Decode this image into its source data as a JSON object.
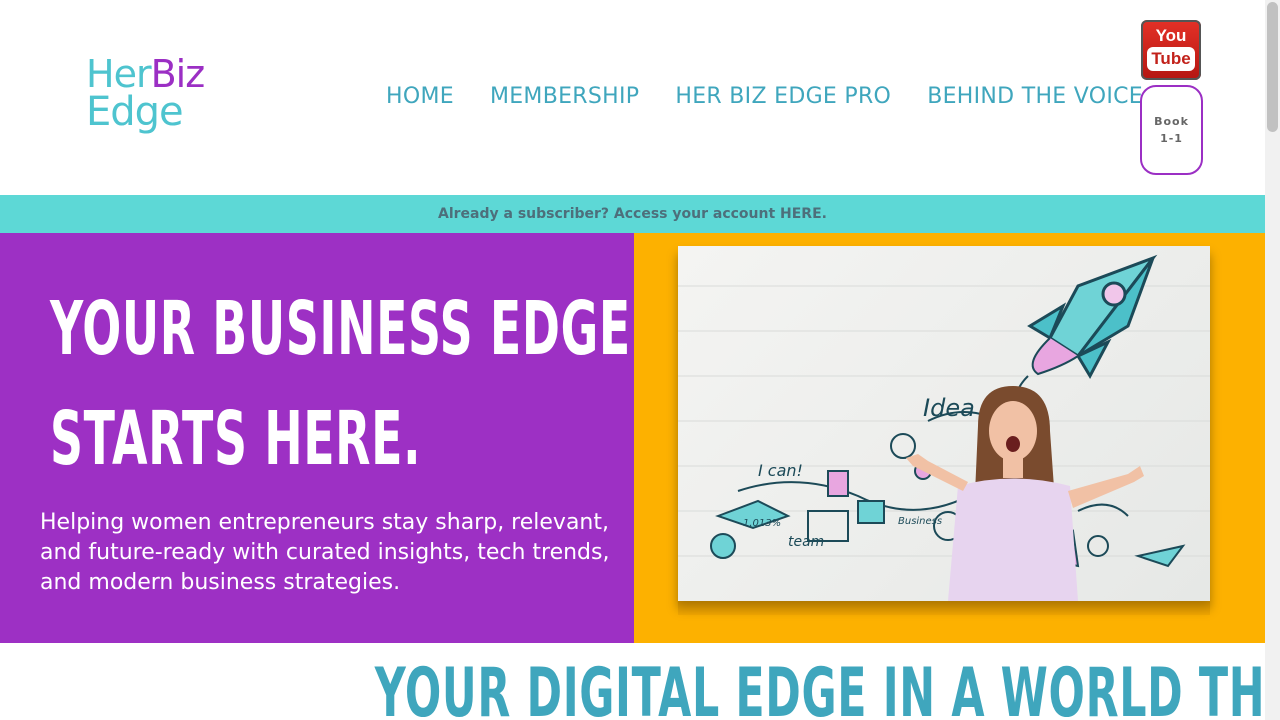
{
  "header": {
    "logo": {
      "line1_a": "Her",
      "line1_b": "Biz",
      "line2": "Edge"
    },
    "nav": [
      "HOME",
      "MEMBERSHIP",
      "HER BIZ EDGE PRO",
      "BEHIND THE VOICE"
    ],
    "youtube": {
      "you": "You",
      "tube": "Tube"
    },
    "book_button": {
      "line1": "Book",
      "line2": "1-1"
    }
  },
  "banner": {
    "text": "Already a subscriber? Access your account HERE."
  },
  "hero": {
    "title_line1": "YOUR BUSINESS EDGE",
    "title_line2": "STARTS HERE.",
    "subtitle": "Helping women entrepreneurs stay sharp, relevant, and future-ready with curated insights, tech trends, and modern business strategies.",
    "image": {
      "board_words": [
        "Idea",
        "I can!",
        "team",
        "1.013%",
        "Business"
      ]
    }
  },
  "section": {
    "title": "YOUR DIGITAL EDGE IN A WORLD THAT WON’T WAIT"
  },
  "colors": {
    "teal": "#3fa6bd",
    "purple": "#9d30c4",
    "banner": "#5dd8d6",
    "orange": "#fdb100"
  }
}
